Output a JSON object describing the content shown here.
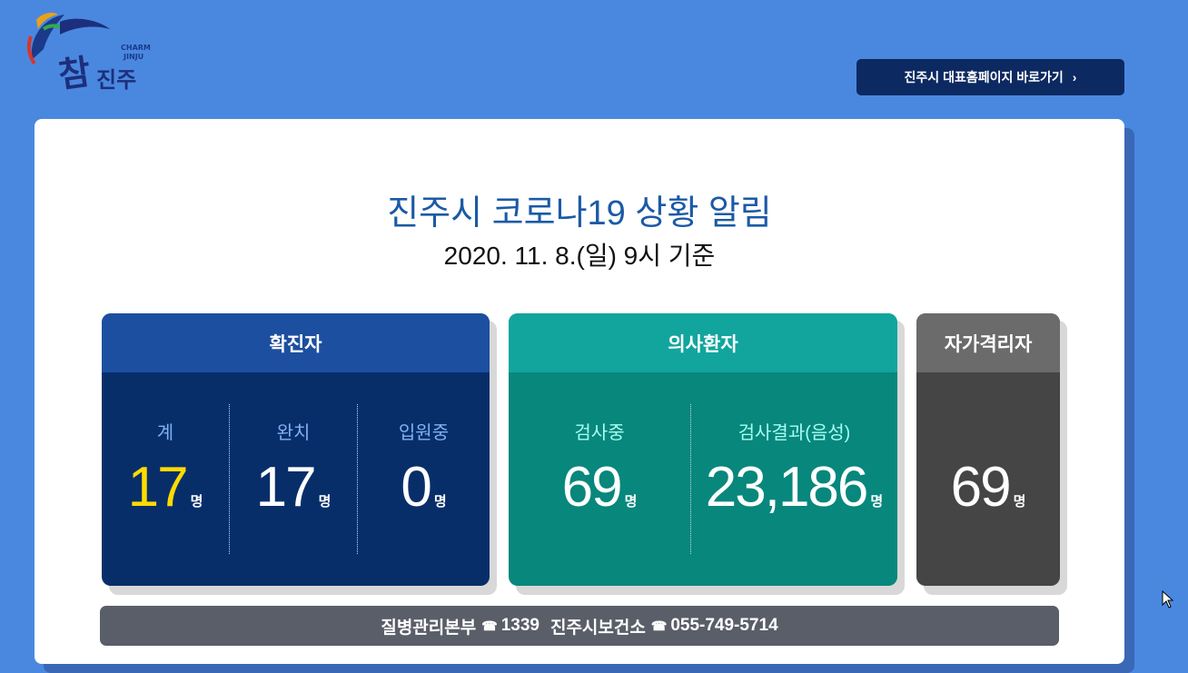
{
  "logo": {
    "brand_en_1": "CHARM",
    "brand_en_2": "JINJU",
    "brand_kr_1": "참",
    "brand_kr_2": "진주"
  },
  "header": {
    "home_link_label": "진주시 대표홈페이지 바로가기",
    "home_link_icon": "chevron-right-icon"
  },
  "main": {
    "title": "진주시 코로나19 상황 알림",
    "subtitle": "2020. 11. 8.(일) 9시 기준"
  },
  "confirmed": {
    "heading": "확진자",
    "total_label": "계",
    "total_value": "17",
    "recovered_label": "완치",
    "recovered_value": "17",
    "hospitalized_label": "입원중",
    "hospitalized_value": "0",
    "unit": "명"
  },
  "suspected": {
    "heading": "의사환자",
    "testing_label": "검사중",
    "testing_value": "69",
    "negative_label": "검사결과(음성)",
    "negative_value": "23,186",
    "unit": "명"
  },
  "quarantine": {
    "heading": "자가격리자",
    "value": "69",
    "unit": "명"
  },
  "footer": {
    "kdca_label": "질병관리본부",
    "kdca_phone": "1339",
    "health_center_label": "진주시보건소",
    "health_center_phone": "055-749-5714",
    "phone_icon": "☎"
  },
  "colors": {
    "background": "#4a88e0",
    "navy": "#082e6a",
    "teal": "#08877c",
    "gray": "#454545",
    "highlight": "#ffdb00"
  }
}
